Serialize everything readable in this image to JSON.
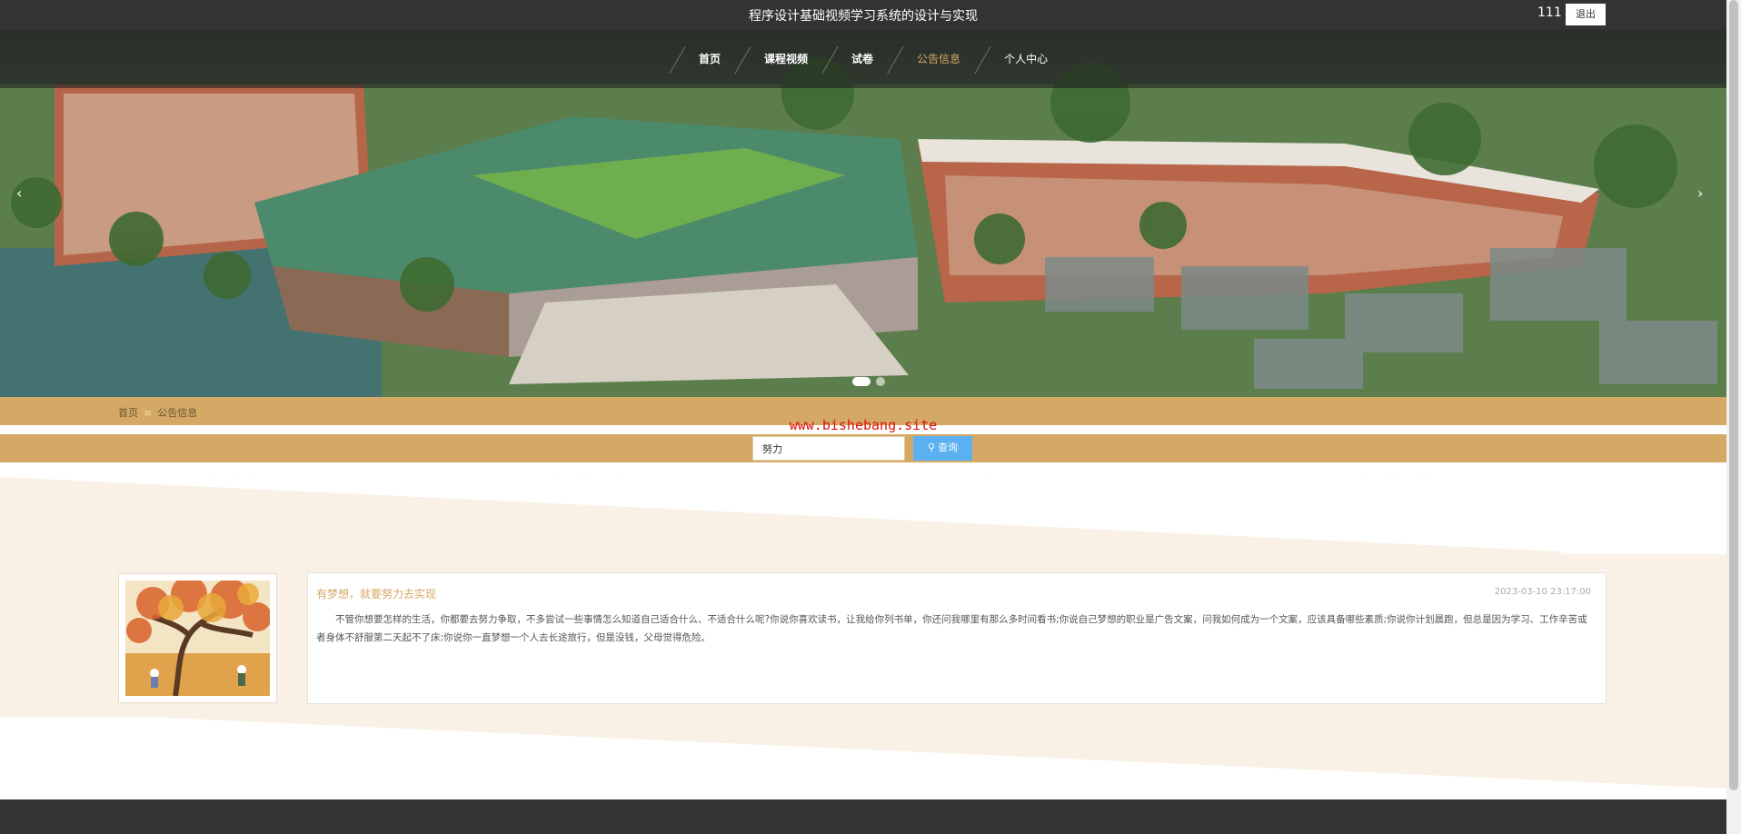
{
  "header": {
    "site_title": "程序设计基础视频学习系统的设计与实现",
    "user_name": "111",
    "logout_label": "退出"
  },
  "nav": {
    "items": [
      {
        "label": "首页"
      },
      {
        "label": "课程视频"
      },
      {
        "label": "试卷"
      },
      {
        "label": "公告信息",
        "active": true
      },
      {
        "label": "个人中心"
      }
    ]
  },
  "carousel": {
    "prev_icon": "‹",
    "next_icon": "›",
    "slide_count": 2,
    "active_index": 0
  },
  "breadcrumb": {
    "home": "首页",
    "separator": "≡",
    "current": "公告信息"
  },
  "watermark": "www.bishebang.site",
  "search": {
    "value": "努力",
    "button_label": "查询"
  },
  "announcement": {
    "title": "有梦想，就要努力去实现",
    "date": "2023-03-10 23:17:00",
    "body": "不管你想要怎样的生活，你都要去努力争取，不多尝试一些事情怎么知道自己适合什么、不适合什么呢?你说你喜欢读书，让我给你列书单，你还问我哪里有那么多时间看书;你说自己梦想的职业是广告文案，问我如何成为一个文案，应该具备哪些素质;你说你计划晨跑，但总是因为学习、工作辛苦或者身体不舒服第二天起不了床;你说你一直梦想一个人去长途旅行，但是没钱，父母觉得危险。"
  },
  "colors": {
    "accent": "#d4a865",
    "topbar": "#333333",
    "search_button": "#5ab0f0",
    "watermark": "#dd1111",
    "content_bg": "#faf1e6"
  }
}
